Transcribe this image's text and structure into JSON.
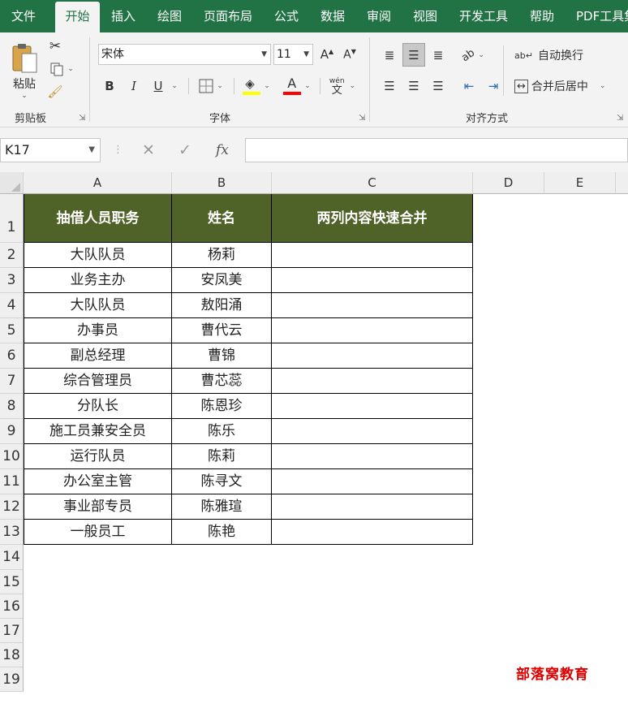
{
  "menu": {
    "tabs": [
      "文件",
      "开始",
      "插入",
      "绘图",
      "页面布局",
      "公式",
      "数据",
      "审阅",
      "视图",
      "开发工具",
      "帮助",
      "PDF工具集"
    ],
    "active": "开始"
  },
  "ribbon": {
    "clipboard": {
      "label": "剪贴板",
      "paste": "粘贴"
    },
    "font": {
      "label": "字体",
      "name": "宋体",
      "size": "11",
      "bold": "B",
      "italic": "I",
      "underline": "U",
      "font_color_glyph": "A",
      "phonetic_top": "wén",
      "phonetic_bottom": "文",
      "fill_color": "#ffff00",
      "font_color": "#ff0000"
    },
    "alignment": {
      "label": "对齐方式",
      "wrap_text": "自动换行",
      "merge_center": "合并后居中"
    }
  },
  "formula_bar": {
    "name_box": "K17",
    "fx": "fx",
    "content": ""
  },
  "sheet": {
    "columns": [
      "A",
      "B",
      "C",
      "D",
      "E"
    ],
    "rows": [
      "1",
      "2",
      "3",
      "4",
      "5",
      "6",
      "7",
      "8",
      "9",
      "10",
      "11",
      "12",
      "13",
      "14",
      "15",
      "16",
      "17",
      "18",
      "19"
    ],
    "header_fill": "#4f6228",
    "headers": [
      "抽借人员职务",
      "姓名",
      "两列内容快速合并"
    ],
    "data": [
      [
        "大队队员",
        "杨莉",
        ""
      ],
      [
        "业务主办",
        "安凤美",
        ""
      ],
      [
        "大队队员",
        "敖阳涌",
        ""
      ],
      [
        "办事员",
        "曹代云",
        ""
      ],
      [
        "副总经理",
        "曹锦",
        ""
      ],
      [
        "综合管理员",
        "曹芯蕊",
        ""
      ],
      [
        "分队长",
        "陈恩珍",
        ""
      ],
      [
        "施工员兼安全员",
        "陈乐",
        ""
      ],
      [
        "运行队员",
        "陈莉",
        ""
      ],
      [
        "办公室主管",
        "陈寻文",
        ""
      ],
      [
        "事业部专员",
        "陈雅瑄",
        ""
      ],
      [
        "一般员工",
        "陈艳",
        ""
      ]
    ]
  },
  "watermark": {
    "text": "部落窝教育",
    "color": "#e00000"
  }
}
